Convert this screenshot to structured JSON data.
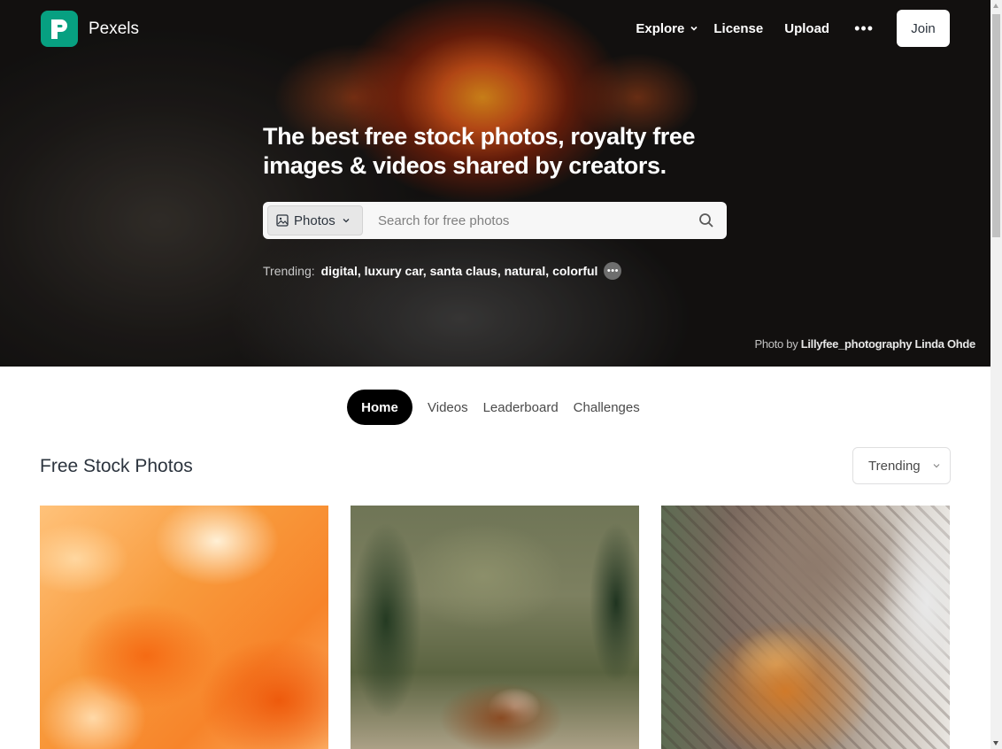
{
  "header": {
    "brand": "Pexels",
    "nav": {
      "explore": "Explore",
      "license": "License",
      "upload": "Upload",
      "more": "•••",
      "join": "Join"
    }
  },
  "hero": {
    "title": "The best free stock photos, royalty free images & videos shared by creators.",
    "search": {
      "type_label": "Photos",
      "placeholder": "Search for free photos"
    },
    "trending": {
      "label": "Trending:",
      "items": [
        "digital,",
        "luxury car,",
        "santa claus,",
        "natural,",
        "colorful"
      ],
      "more": "•••"
    },
    "credit": {
      "prefix": "Photo by",
      "author": "Lillyfee_photography Linda Ohde"
    }
  },
  "tabs": [
    "Home",
    "Videos",
    "Leaderboard",
    "Challenges"
  ],
  "section": {
    "title": "Free Stock Photos",
    "sort": "Trending"
  },
  "colors": {
    "brand": "#07a081",
    "active_tab": "#000000"
  },
  "icons": [
    "pexels-logo-icon",
    "chevron-down-icon",
    "image-icon",
    "search-icon"
  ]
}
